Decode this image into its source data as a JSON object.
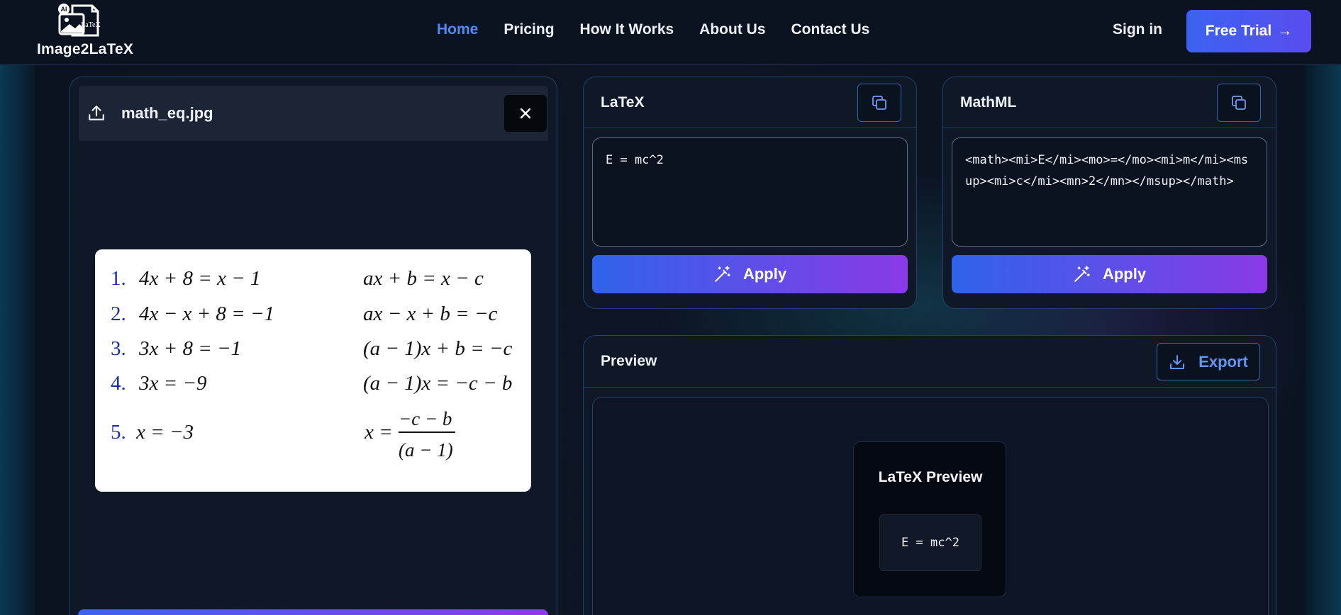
{
  "header": {
    "logo_text": "Image2LaTeX",
    "logo_badge": "AI",
    "logo_mark": "LaTeX",
    "nav": [
      {
        "label": "Home",
        "active": true
      },
      {
        "label": "Pricing"
      },
      {
        "label": "How It Works"
      },
      {
        "label": "About Us"
      },
      {
        "label": "Contact Us"
      }
    ],
    "sign_in": "Sign in",
    "free_trial": "Free Trial",
    "free_trial_arrow": "→"
  },
  "upload": {
    "file_name": "math_eq.jpg",
    "upload_icon": "upload-icon",
    "close_icon": "close-icon",
    "image": {
      "rows": [
        {
          "num": "1.",
          "left": "4x + 8 = x − 1",
          "right": "ax + b = x − c"
        },
        {
          "num": "2.",
          "left": "4x − x + 8 = −1",
          "right": "ax − x + b = −c"
        },
        {
          "num": "3.",
          "left": "3x + 8 = −1",
          "right": "(a − 1)x + b = −c"
        },
        {
          "num": "4.",
          "left": "3x = −9",
          "right": "(a − 1)x = −c − b"
        },
        {
          "num": "5.",
          "left": "x = −3",
          "right_prefix": "x =",
          "frac_num": "−c − b",
          "frac_den": "(a − 1)"
        }
      ]
    }
  },
  "latex": {
    "title": "LaTeX",
    "code": "E = mc^2",
    "apply": "Apply"
  },
  "mathml": {
    "title": "MathML",
    "code": "<math><mi>E</mi><mo>=</mo><mi>m</mi><msup><mi>c</mi><mn>2</mn></msup></math>",
    "apply": "Apply"
  },
  "preview": {
    "title": "Preview",
    "export": "Export",
    "card_title": "LaTeX Preview",
    "formula": "E = mc^2"
  },
  "colors": {
    "accent": "#4e8bf5",
    "gradient_start": "#2f63ea",
    "gradient_end": "#8a3ae6",
    "background": "#0b1320"
  }
}
